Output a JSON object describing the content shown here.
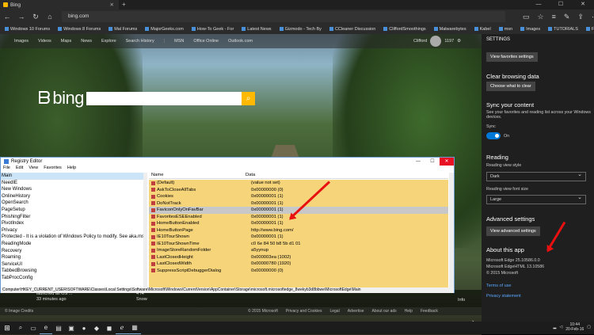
{
  "window": {
    "tab_title": "Bing",
    "url": "bing.com"
  },
  "controls": {
    "minimize": "—",
    "maximize": "☐",
    "close": "✕",
    "newtab": "+"
  },
  "favorites": [
    "Windows 10 Forums",
    "Windows 8 Forums",
    "Mal Forums",
    "MajorGeeks.com",
    "How-To Geek - For",
    "Latest News",
    "Gizmodo - Tech By",
    "CCleaner Discussion",
    "CliffordSmoothings",
    "Malwarebytes",
    "Kabel",
    "msn",
    "Images",
    "TUTORIALS",
    "FRITZ!Box"
  ],
  "bing": {
    "nav": [
      "Images",
      "Videos",
      "Maps",
      "News",
      "Explore",
      "Search History",
      "|",
      "MSN",
      "Office Online",
      "Outlook.com"
    ],
    "user": "Clifford",
    "rewards": "1197",
    "logo": "bing",
    "news_a": [
      "launched as OS ...",
      "33 minutes ago"
    ],
    "news_b": [
      "4°/4°",
      "Snow"
    ],
    "info": "Info",
    "footer_left": "© Image Credits",
    "footer_right": [
      "© 2015 Microsoft",
      "Privacy and Cookies",
      "Legal",
      "Advertise",
      "About our ads",
      "Help",
      "Feedback"
    ]
  },
  "settings": {
    "title": "SETTINGS",
    "view_fav_btn": "View favorites settings",
    "clear_title": "Clear browsing data",
    "choose_btn": "Choose what to clear",
    "sync_title": "Sync your content",
    "sync_desc": [
      "See your favorites and reading list across your Windows",
      "devices."
    ],
    "sync_label": "Sync",
    "sync_state": "On",
    "reading_title": "Reading",
    "view_style_label": "Reading view style",
    "view_style_value": "Dark",
    "font_size_label": "Reading view font size",
    "font_size_value": "Large",
    "adv_title": "Advanced settings",
    "adv_btn": "View advanced settings",
    "about_title": "About this app",
    "about_lines": [
      "Microsoft Edge 25.10586.0.0",
      "Microsoft EdgeHTML 13.10586",
      "© 2015 Microsoft"
    ],
    "terms": "Terms of use",
    "privacy": "Privacy statement"
  },
  "regedit": {
    "title": "Registry Editor",
    "menu": [
      "File",
      "Edit",
      "View",
      "Favorites",
      "Help"
    ],
    "tree": [
      "Main",
      "NeedIE",
      "New Windows",
      "OnlineHistory",
      "OpenSearch",
      "PageSetup",
      "PhishingFilter",
      "PivotIndex",
      "Privacy",
      "Protected - It is a violation of Windows Policy to modify. See aka.ms",
      "ReadingMode",
      "Recovery",
      "Roaming",
      "ServiceUI",
      "TabbedBrowsing",
      "TabProcConfig"
    ],
    "col_name": "Name",
    "col_data": "Data",
    "rows": [
      {
        "name": "(Default)",
        "data": "(value not set)"
      },
      {
        "name": "AskToCloseAllTabs",
        "data": "0x00000000 (0)"
      },
      {
        "name": "Cookies",
        "data": "0x00000001 (1)"
      },
      {
        "name": "DoNotTrack",
        "data": "0x00000001 (1)"
      },
      {
        "name": "FaviconOnlyOnFavBar",
        "data": "0x00000001 (1)"
      },
      {
        "name": "FavoritesESEEnabled",
        "data": "0x00000001 (1)"
      },
      {
        "name": "HomeButtonEnabled",
        "data": "0x00000001 (1)"
      },
      {
        "name": "HomeButtonPage",
        "data": "http://www.bing.com/"
      },
      {
        "name": "IE10TourShown",
        "data": "0x00000001 (1)"
      },
      {
        "name": "IE10TourShownTime",
        "data": "c0 6e 84 50 b8 5b d1 01"
      },
      {
        "name": "ImageStoreRandomFolder",
        "data": "a5yynup"
      },
      {
        "name": "LastClosedHeight",
        "data": "0x000003ea (1002)"
      },
      {
        "name": "LastClosedWidth",
        "data": "0x00000780 (1920)"
      },
      {
        "name": "SuppressScriptDebuggerDialog",
        "data": "0x00000000 (0)"
      }
    ],
    "status": "Computer\\HKEY_CURRENT_USER\\SOFTWARE\\Classes\\Local Settings\\Software\\Microsoft\\Windows\\CurrentVersion\\AppContainer\\Storage\\microsoft.microsoftedge_8wekyb3d8bbwe\\MicrosoftEdge\\Main"
  },
  "taskbar": {
    "time": "10:44",
    "date": "20-Feb-16"
  }
}
